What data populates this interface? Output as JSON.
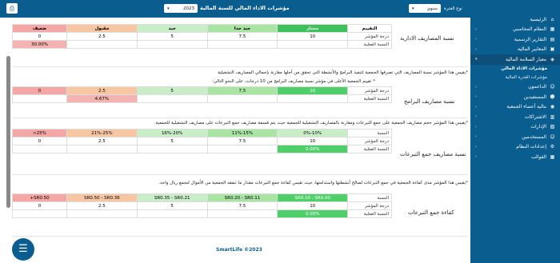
{
  "topbar": {
    "title": "مؤشرات الاداء المالي للسنة المالية",
    "year": "2023",
    "type_label": "نوع الفترة",
    "type_value": "سنوي",
    "print_icon": "print-icon"
  },
  "sidebar": {
    "items": [
      {
        "label": "الرئيسية",
        "icon": "home-icon"
      },
      {
        "label": "النظام المحاسبي",
        "icon": "calc-icon"
      },
      {
        "label": "التقارير الرسمية",
        "icon": "report-icon"
      },
      {
        "label": "المعايير المالية",
        "icon": "doc-icon"
      },
      {
        "label": "معيار السلامة المالية",
        "icon": "shield-icon"
      }
    ],
    "subitems": [
      {
        "label": "مؤشرات الاداء المالي"
      },
      {
        "label": "مؤشرات القدرة المالية"
      }
    ],
    "items2": [
      {
        "label": "الداعمون",
        "icon": "users-icon"
      },
      {
        "label": "المستفيدين",
        "icon": "person-icon"
      },
      {
        "label": "مالية أعضاء الجمعية",
        "icon": "group-icon"
      },
      {
        "label": "الاشتراكات",
        "icon": "sub-icon"
      },
      {
        "label": "الإدارات",
        "icon": "dept-icon"
      },
      {
        "label": "المستخدمين",
        "icon": "user-icon"
      },
      {
        "label": "إعدادات النظام",
        "icon": "gear-icon"
      },
      {
        "label": "القوالب",
        "icon": "template-icon"
      }
    ]
  },
  "sections": [
    {
      "category": "نسبة المصاريف الادارية",
      "header_label": "التقييم",
      "ratings": [
        "ضعيف",
        "مقبول",
        "جيد",
        "جيد جدا",
        "ممتاز"
      ],
      "row_label_score": "درجة المؤشر",
      "scores": [
        "0",
        "2.5",
        "5",
        "7.5",
        "10"
      ],
      "row_label_actual": "النسبة الفعلية",
      "actual": "30.00%"
    },
    {
      "category": "نسبة مصاريف البرامج",
      "desc1": "*يقيس هذا المؤشر نسبة المصاريف التي تصرفها الجمعية لتنفيذ البرامج والأنشطة التي تحقق من أجلها مقارنة بإجمالي المصاريف التشغيلية",
      "desc2": "* تقييم الجمعية الأعلى في مؤشر نسبة مصاريف البرامج من 10 درجات، على النحو التالي:",
      "row_label_score": "درجة المؤشر",
      "scores": [
        "0",
        "2.5",
        "5",
        "7.5",
        "10"
      ],
      "row_label_actual": "النسبة الفعلية",
      "actual": "4.67%"
    },
    {
      "category": "نسبة مصاريف جمع التبرعات",
      "desc1": "*يقيس هذا المؤشر حجم مصاريف الجمعية على جمع التبرعات ومقارنة بالمصاريف التشغيلية للجمعية حيث يتم قسمة مصاريف جمع التبرعات على مصاريف التشغيلية للجمعية.",
      "row_label_ratio": "النسبة",
      "ratios": [
        ">25%",
        "21%-25%",
        "16%-20%",
        "11%-15%",
        "0%-10%"
      ],
      "row_label_score": "درجة المؤشر",
      "scores": [
        "0",
        "2.5",
        "5",
        "7.5",
        "10"
      ],
      "row_label_actual": "النسبة الفعلية",
      "actual": "0.00%"
    },
    {
      "category": "كفاءة جمع التبرعات",
      "desc1": "*يقيس هذا المؤشر مدى كفاءة الجمعية في جمع التبرعات لصالح أنشطتها واستدامتها، حيث تقيس كفاءة جمع التبرعات مقدار ما تنفقه الجمعية من الأموال لتجمع ريال واحد.",
      "row_label_ratio": "النسبة",
      "ratios": [
        "+SR0.50",
        "SR0.50 - SR0.36",
        "SR0.35 - SR0.21",
        "SR0.20 - SR0.11",
        "SR0.10 - SR0.00"
      ],
      "row_label_score": "درجة المؤشر",
      "scores": [
        "0",
        "2.5",
        "5",
        "7.5",
        "10"
      ],
      "row_label_actual": "النسبة الفعلية",
      "actual": "0.00%"
    }
  ],
  "footer": {
    "text": "SmartLife ©2023"
  },
  "chat_icon": "chat-icon"
}
